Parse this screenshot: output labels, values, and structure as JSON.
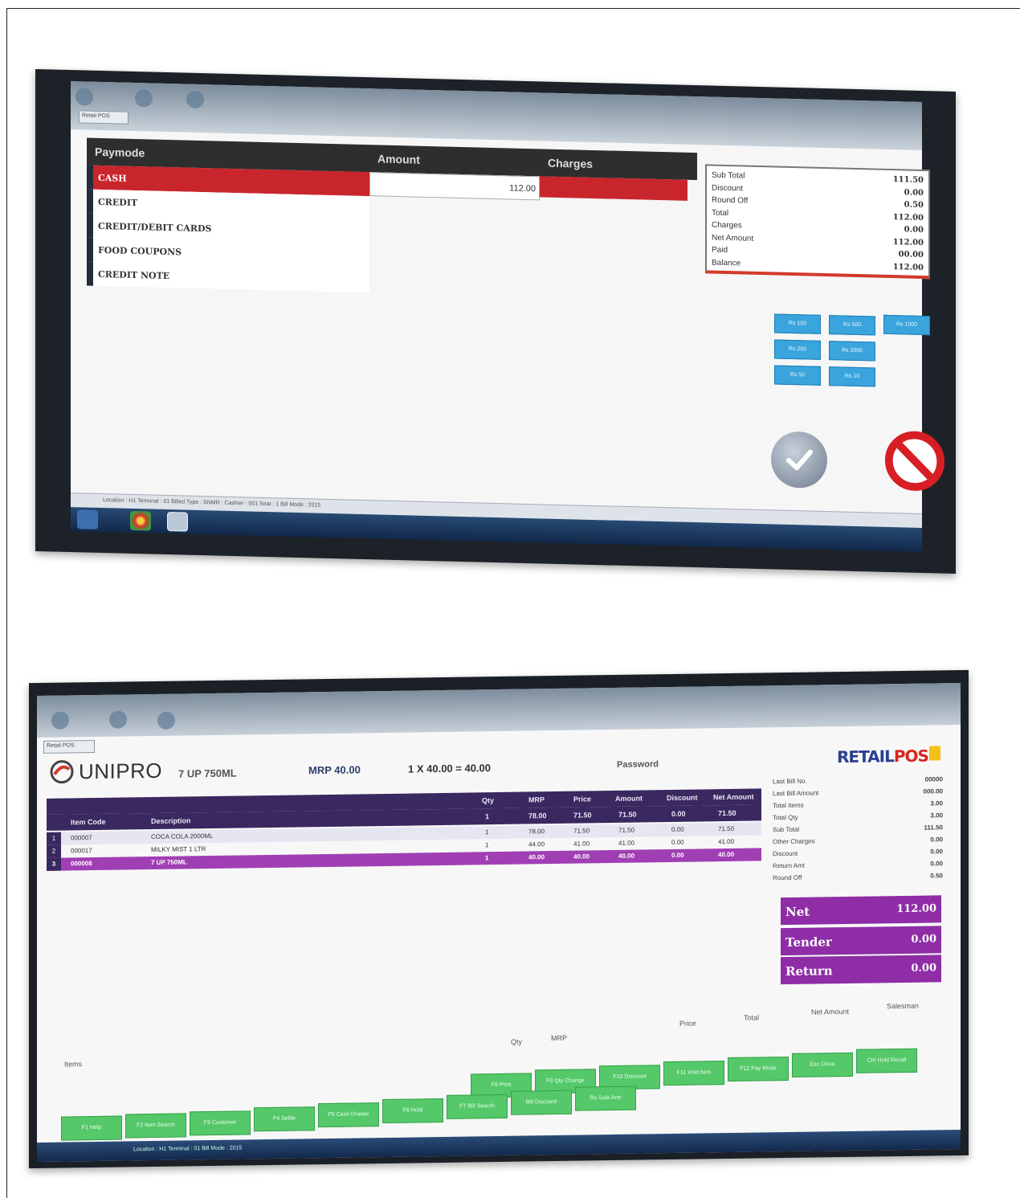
{
  "payment_screen": {
    "window_tab": "Retail POS",
    "headers": {
      "paymode": "Paymode",
      "amount": "Amount",
      "charges": "Charges"
    },
    "paymodes": [
      "CASH",
      "CREDIT",
      "CREDIT/DEBIT CARDS",
      "FOOD COUPONS",
      "CREDIT NOTE"
    ],
    "selected_paymode": "CASH",
    "amount_value": "112.00",
    "summary": [
      {
        "label": "Sub Total",
        "value": "111.50"
      },
      {
        "label": "Discount",
        "value": "0.00"
      },
      {
        "label": "Round Off",
        "value": "0.50"
      },
      {
        "label": "Total",
        "value": "112.00"
      },
      {
        "label": "Charges",
        "value": "0.00"
      },
      {
        "label": "Net Amount",
        "value": "112.00"
      },
      {
        "label": "Paid",
        "value": "00.00"
      },
      {
        "label": "Balance",
        "value": "112.00"
      }
    ],
    "quick_buttons": [
      "Rs 100",
      "Rs 500",
      "Rs 1000",
      "Rs 200",
      "Rs 2000",
      "Rs 50",
      "Rs 10"
    ],
    "status_bar": "Location : H1  Terminal : 01  Billed Type :   SNMR :   Cashier : 001  Seat : 1  Bill Mode : 2015"
  },
  "billing_screen": {
    "window_tab": "Retail POS",
    "logo_text": "UNIPRO",
    "item_name": "7 UP 750ML",
    "mrp": "MRP 40.00",
    "calc": "1 X 40.00 = 40.00",
    "password_label": "Password",
    "brand_left": "RETAIL",
    "brand_right": "POS",
    "columns": [
      "Item Code",
      "Description",
      "Qty",
      "MRP",
      "Price",
      "Amount",
      "Discount",
      "Net Amount"
    ],
    "rows": [
      {
        "num": "1",
        "code": "000007",
        "desc": "COCA COLA 2000ML",
        "qty": "1",
        "mrp": "78.00",
        "price": "71.50",
        "amount": "71.50",
        "disc": "0.00",
        "net": "71.50"
      },
      {
        "num": "2",
        "code": "000017",
        "desc": "MILKY MIST 1 LTR",
        "qty": "1",
        "mrp": "44.00",
        "price": "41.00",
        "amount": "41.00",
        "disc": "0.00",
        "net": "41.00"
      },
      {
        "num": "3",
        "code": "000008",
        "desc": "7 UP 750ML",
        "qty": "1",
        "mrp": "40.00",
        "price": "40.00",
        "amount": "40.00",
        "disc": "0.00",
        "net": "40.00"
      }
    ],
    "stats": [
      {
        "label": "Last Bill No.",
        "value": "00000"
      },
      {
        "label": "Last Bill Amount",
        "value": "000.00"
      },
      {
        "label": "Total Items",
        "value": "3.00"
      },
      {
        "label": "Total Qty",
        "value": "3.00"
      },
      {
        "label": "Sub Total",
        "value": "111.50"
      },
      {
        "label": "Other Charges",
        "value": "0.00"
      },
      {
        "label": "Discount",
        "value": "0.00"
      },
      {
        "label": "Return Amt",
        "value": "0.00"
      },
      {
        "label": "Round Off",
        "value": "0.50"
      }
    ],
    "net": {
      "label": "Net",
      "value": "112.00"
    },
    "tender": {
      "label": "Tender",
      "value": "0.00"
    },
    "return": {
      "label": "Return",
      "value": "0.00"
    },
    "footer": {
      "qty": "Qty",
      "mrp": "MRP",
      "price": "Price",
      "total": "Total",
      "net_amount": "Net Amount",
      "salesman": "Salesman",
      "items": "Items"
    },
    "green_buttons_top": [
      "F8 Print",
      "F9 Qty Change",
      "F10 Discount",
      "F11 Void Item",
      "F12 Pay Mode",
      "Esc Close",
      "Ctrl Hold Recall"
    ],
    "green_buttons_bottom": [
      "F1 Help",
      "F2 Item Search",
      "F3 Customer",
      "F4 Settle",
      "F5 Cash Drawer",
      "F6 Hold",
      "F7 Bill Search",
      "Bill Discount",
      "Rs Sale Amt"
    ],
    "status_bar": "Location : H1  Terminal : 01  Bill Mode : 2015"
  }
}
